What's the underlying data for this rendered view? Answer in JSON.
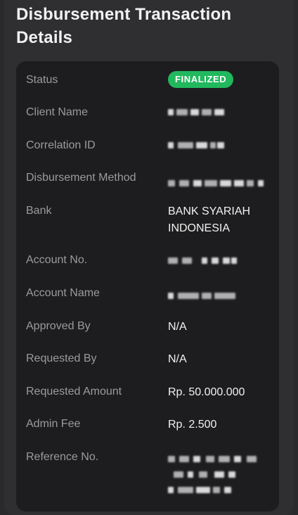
{
  "page": {
    "title": "Disbursement Transaction Details"
  },
  "details": {
    "status_label": "Status",
    "status_value": "FINALIZED",
    "client_name_label": "Client Name",
    "correlation_id_label": "Correlation ID",
    "disbursement_method_label": "Disbursement Method",
    "bank_label": "Bank",
    "bank_value": "BANK SYARIAH INDONESIA",
    "account_no_label": "Account No.",
    "account_name_label": "Account Name",
    "approved_by_label": "Approved By",
    "approved_by_value": "N/A",
    "requested_by_label": "Requested By",
    "requested_by_value": "N/A",
    "requested_amount_label": "Requested Amount",
    "requested_amount_value": "Rp. 50.000.000",
    "admin_fee_label": "Admin Fee",
    "admin_fee_value": "Rp. 2.500",
    "reference_no_label": "Reference No."
  },
  "colors": {
    "status_badge": "#21b85e",
    "card_background": "#1d1d1f",
    "label_text": "#9b9b9e"
  }
}
